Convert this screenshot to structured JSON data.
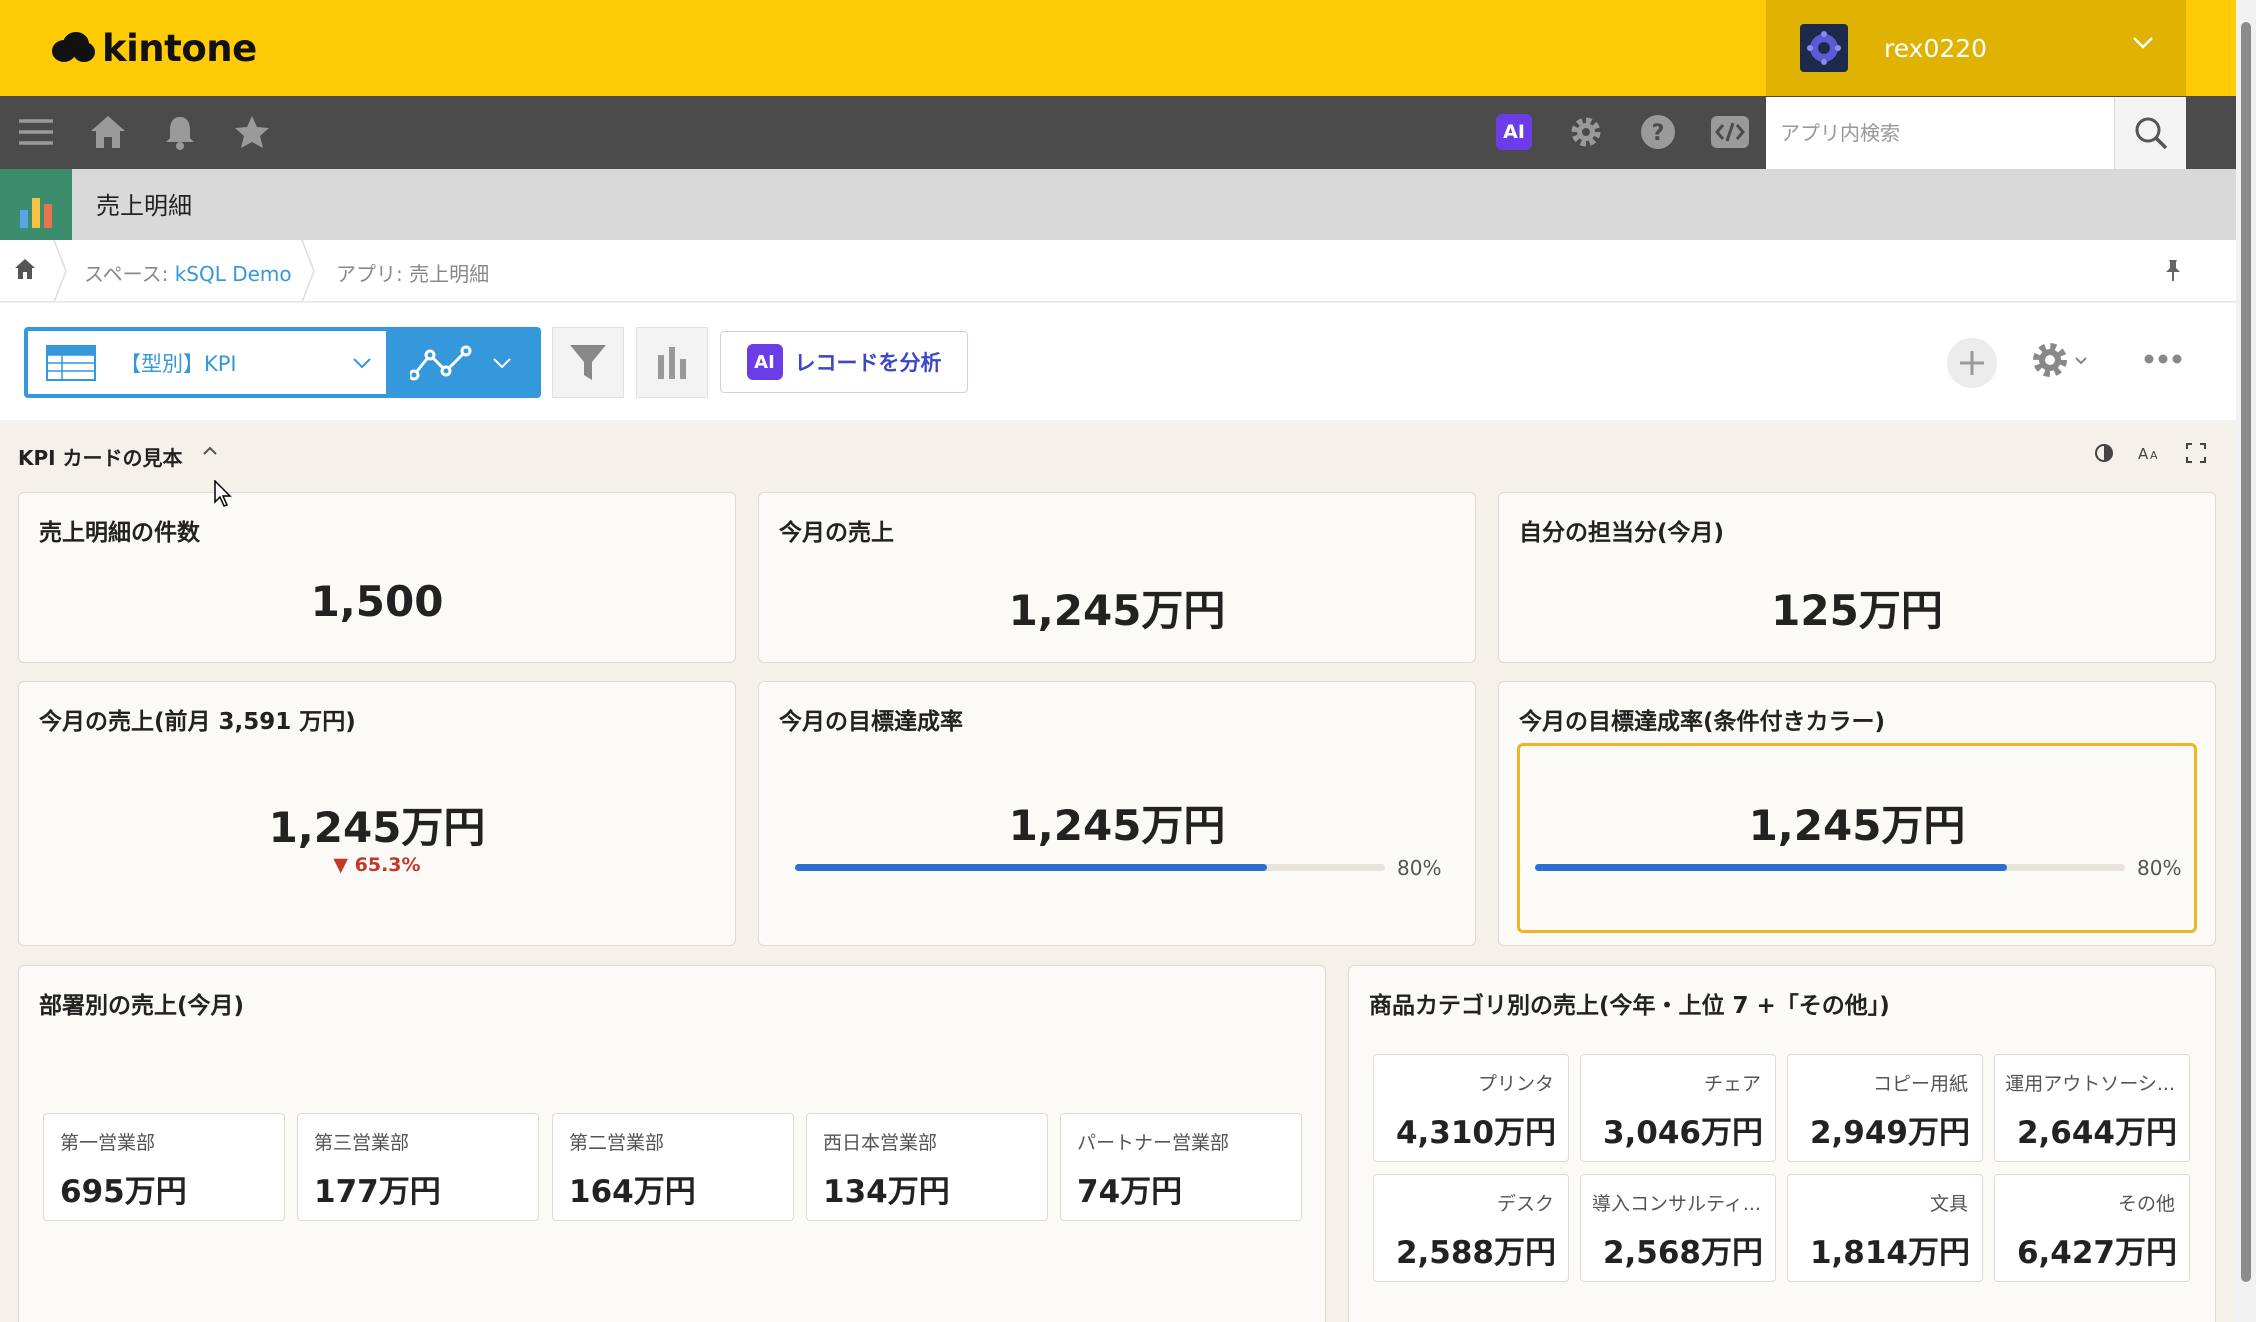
{
  "header": {
    "logo_text": "kintone",
    "username": "rex0220"
  },
  "toolbar": {
    "ai_label": "AI",
    "search_placeholder": "アプリ内検索"
  },
  "app": {
    "name": "売上明細"
  },
  "breadcrumb": {
    "space_prefix": "スペース: ",
    "space_name": "kSQL Demo",
    "app_label": "アプリ: 売上明細"
  },
  "view": {
    "selected": "【型別】KPI",
    "ai_analyze_label": "レコードを分析",
    "ai_badge": "AI"
  },
  "section": {
    "title": "KPI カードの見本"
  },
  "kpi_cards": [
    {
      "title": "売上明細の件数",
      "value": "1,500"
    },
    {
      "title": "今月の売上",
      "value": "1,245万円"
    },
    {
      "title": "自分の担当分(今月)",
      "value": "125万円"
    },
    {
      "title": "今月の売上(前月 3,591 万円)",
      "value": "1,245万円",
      "change": "▼ 65.3%",
      "change_color": "#c0392b"
    },
    {
      "title": "今月の目標達成率",
      "value": "1,245万円",
      "progress": 0.8,
      "progress_label": "80%"
    },
    {
      "title": "今月の目標達成率(条件付きカラー)",
      "value": "1,245万円",
      "progress": 0.8,
      "progress_label": "80%",
      "highlight_color": "#f0b429"
    }
  ],
  "dept_card": {
    "title": "部署別の売上(今月)",
    "items": [
      {
        "name": "第一営業部",
        "value": "695万円"
      },
      {
        "name": "第三営業部",
        "value": "177万円"
      },
      {
        "name": "第二営業部",
        "value": "164万円"
      },
      {
        "name": "西日本営業部",
        "value": "134万円"
      },
      {
        "name": "パートナー営業部",
        "value": "74万円"
      }
    ]
  },
  "category_card": {
    "title": "商品カテゴリ別の売上(今年・上位 7 +「その他」)",
    "items": [
      {
        "name": "プリンタ",
        "value": "4,310万円"
      },
      {
        "name": "チェア",
        "value": "3,046万円"
      },
      {
        "name": "コピー用紙",
        "value": "2,949万円"
      },
      {
        "name": "運用アウトソーシ...",
        "value": "2,644万円"
      },
      {
        "name": "デスク",
        "value": "2,588万円"
      },
      {
        "name": "導入コンサルティ...",
        "value": "2,568万円"
      },
      {
        "name": "文具",
        "value": "1,814万円"
      },
      {
        "name": "その他",
        "value": "6,427万円"
      }
    ]
  },
  "colors": {
    "brand_yellow": "#ffcb05",
    "toolbar_dark": "#4b4b4b",
    "accent_blue": "#3498db",
    "progress_blue": "#2a6fd1"
  }
}
